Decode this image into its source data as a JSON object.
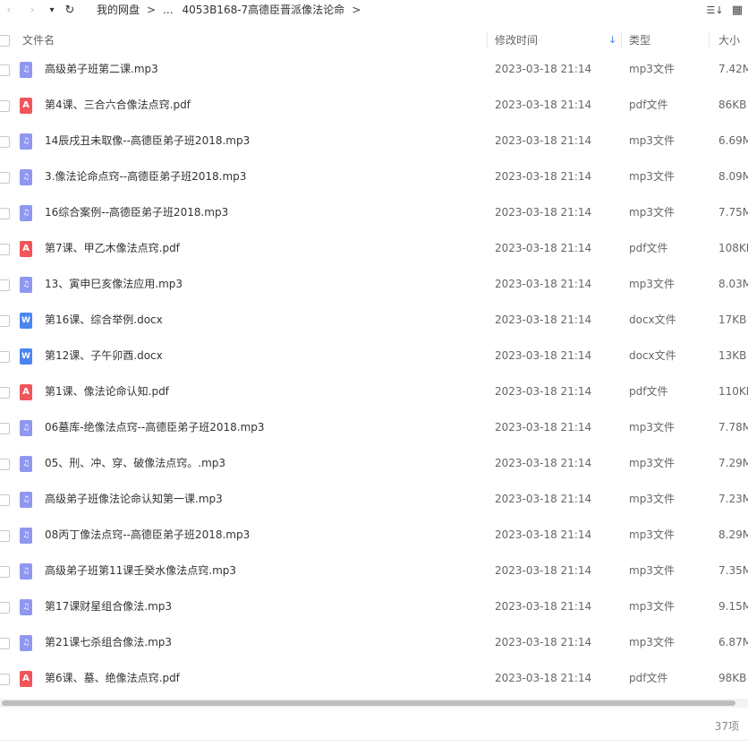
{
  "nav": {
    "back": "‹",
    "forward": "›",
    "history": "▾",
    "refresh": "↻"
  },
  "breadcrumb": {
    "root": "我的网盘",
    "sep": ">",
    "ellipsis": "...",
    "current": "4053B168-7高德臣晋派像法论命"
  },
  "toolbar": {
    "sort_icon": "☰↓",
    "view_icon": "▦"
  },
  "columns": {
    "name": "文件名",
    "date": "修改时间",
    "type": "类型",
    "size": "大小",
    "sort_indicator": "↓"
  },
  "files": [
    {
      "name": "高级弟子班第二课.mp3",
      "date": "2023-03-18 21:14",
      "type": "mp3文件",
      "size": "7.42M",
      "kind": "mp3"
    },
    {
      "name": "第4课、三合六合像法点窍.pdf",
      "date": "2023-03-18 21:14",
      "type": "pdf文件",
      "size": "86KB",
      "kind": "pdf"
    },
    {
      "name": "14辰戌丑未取像--高德臣弟子班2018.mp3",
      "date": "2023-03-18 21:14",
      "type": "mp3文件",
      "size": "6.69M",
      "kind": "mp3"
    },
    {
      "name": "3.像法论命点窍--高德臣弟子班2018.mp3",
      "date": "2023-03-18 21:14",
      "type": "mp3文件",
      "size": "8.09M",
      "kind": "mp3"
    },
    {
      "name": "16综合案例--高德臣弟子班2018.mp3",
      "date": "2023-03-18 21:14",
      "type": "mp3文件",
      "size": "7.75M",
      "kind": "mp3"
    },
    {
      "name": "第7课、甲乙木像法点窍.pdf",
      "date": "2023-03-18 21:14",
      "type": "pdf文件",
      "size": "108KB",
      "kind": "pdf"
    },
    {
      "name": "13、寅申巳亥像法应用.mp3",
      "date": "2023-03-18 21:14",
      "type": "mp3文件",
      "size": "8.03M",
      "kind": "mp3"
    },
    {
      "name": "第16课、综合举例.docx",
      "date": "2023-03-18 21:14",
      "type": "docx文件",
      "size": "17KB",
      "kind": "docx"
    },
    {
      "name": "第12课、子午卯酉.docx",
      "date": "2023-03-18 21:14",
      "type": "docx文件",
      "size": "13KB",
      "kind": "docx"
    },
    {
      "name": "第1课、像法论命认知.pdf",
      "date": "2023-03-18 21:14",
      "type": "pdf文件",
      "size": "110KB",
      "kind": "pdf"
    },
    {
      "name": "06墓库-绝像法点窍--高德臣弟子班2018.mp3",
      "date": "2023-03-18 21:14",
      "type": "mp3文件",
      "size": "7.78M",
      "kind": "mp3"
    },
    {
      "name": "05、刑、冲、穿、破像法点窍。.mp3",
      "date": "2023-03-18 21:14",
      "type": "mp3文件",
      "size": "7.29M",
      "kind": "mp3"
    },
    {
      "name": "高级弟子班像法论命认知第一课.mp3",
      "date": "2023-03-18 21:14",
      "type": "mp3文件",
      "size": "7.23M",
      "kind": "mp3"
    },
    {
      "name": "08丙丁像法点窍--高德臣弟子班2018.mp3",
      "date": "2023-03-18 21:14",
      "type": "mp3文件",
      "size": "8.29M",
      "kind": "mp3"
    },
    {
      "name": "高级弟子班第11课壬癸水像法点窍.mp3",
      "date": "2023-03-18 21:14",
      "type": "mp3文件",
      "size": "7.35M",
      "kind": "mp3"
    },
    {
      "name": "第17课财星组合像法.mp3",
      "date": "2023-03-18 21:14",
      "type": "mp3文件",
      "size": "9.15M",
      "kind": "mp3"
    },
    {
      "name": "第21课七杀组合像法.mp3",
      "date": "2023-03-18 21:14",
      "type": "mp3文件",
      "size": "6.87M",
      "kind": "mp3"
    },
    {
      "name": "第6课、墓、绝像法点窍.pdf",
      "date": "2023-03-18 21:14",
      "type": "pdf文件",
      "size": "98KB",
      "kind": "pdf"
    }
  ],
  "footer": {
    "count": "37项"
  }
}
